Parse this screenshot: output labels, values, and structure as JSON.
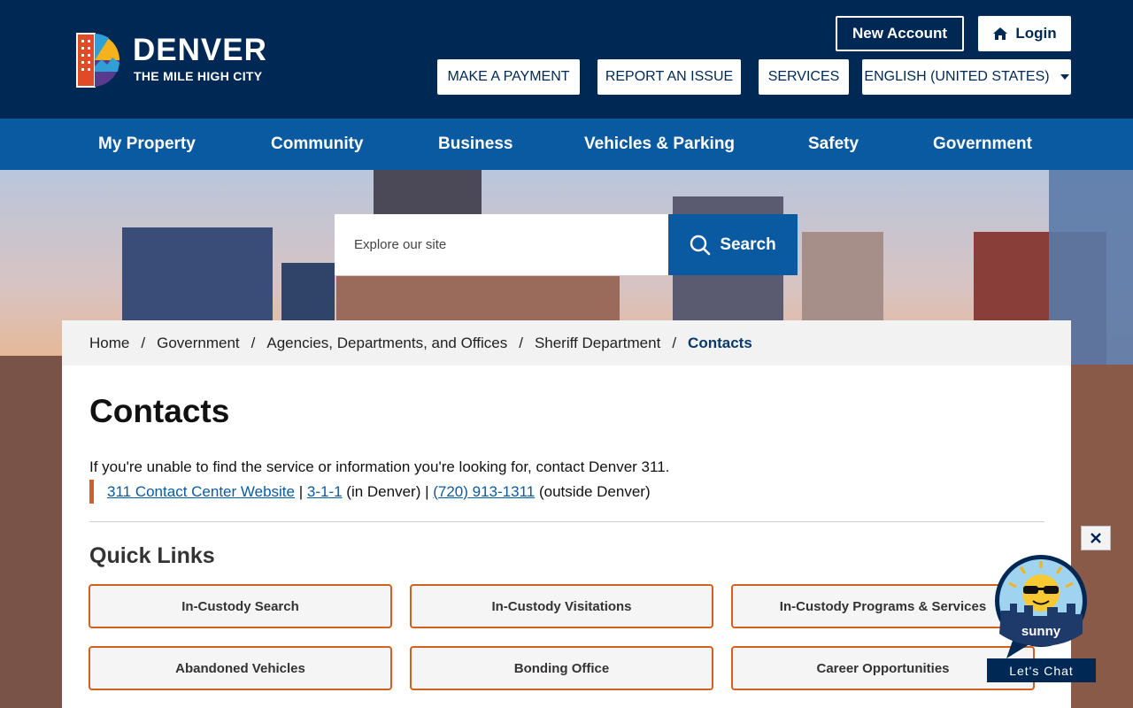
{
  "header": {
    "logo_word": "DENVER",
    "logo_tagline": "THE MILE HIGH CITY",
    "new_account_label": "New Account",
    "login_label": "Login",
    "utility_links": [
      {
        "label": "MAKE A PAYMENT"
      },
      {
        "label": "REPORT AN ISSUE"
      },
      {
        "label": "SERVICES"
      }
    ],
    "language_selected": "ENGLISH (UNITED STATES)"
  },
  "nav": {
    "items": [
      {
        "label": "My Property"
      },
      {
        "label": "Community"
      },
      {
        "label": "Business"
      },
      {
        "label": "Vehicles & Parking"
      },
      {
        "label": "Safety"
      },
      {
        "label": "Government"
      }
    ]
  },
  "search": {
    "placeholder": "Explore our site",
    "button_label": "Search"
  },
  "breadcrumb": {
    "items": [
      {
        "label": "Home"
      },
      {
        "label": "Government"
      },
      {
        "label": "Agencies, Departments, and Offices"
      },
      {
        "label": "Sheriff Department"
      }
    ],
    "current": "Contacts"
  },
  "page": {
    "title": "Contacts",
    "intro": "If you're unable to find the service or information you're looking for, contact Denver 311.",
    "contact": {
      "website_link": "311 Contact Center Website",
      "sep1": " | ",
      "phone_short": "3-1-1",
      "phone_short_note": " (in Denver) | ",
      "phone_long": "(720) 913-1311",
      "phone_long_note": " (outside Denver)"
    }
  },
  "quick_links": {
    "title": "Quick Links",
    "items": [
      {
        "label": "In-Custody Search"
      },
      {
        "label": "In-Custody Visitations"
      },
      {
        "label": "In-Custody Programs & Services"
      },
      {
        "label": "Abandoned Vehicles"
      },
      {
        "label": "Bonding Office"
      },
      {
        "label": "Career Opportunities"
      }
    ]
  },
  "chat": {
    "bot_name": "sunny",
    "label": "Let's Chat"
  },
  "colors": {
    "header_navy": "#002855",
    "nav_blue": "#0a5aa1",
    "accent_orange": "#d35f20"
  },
  "icons": [
    "home-icon",
    "search-icon",
    "chevron-down-icon",
    "close-icon",
    "sunny-sun-icon"
  ]
}
